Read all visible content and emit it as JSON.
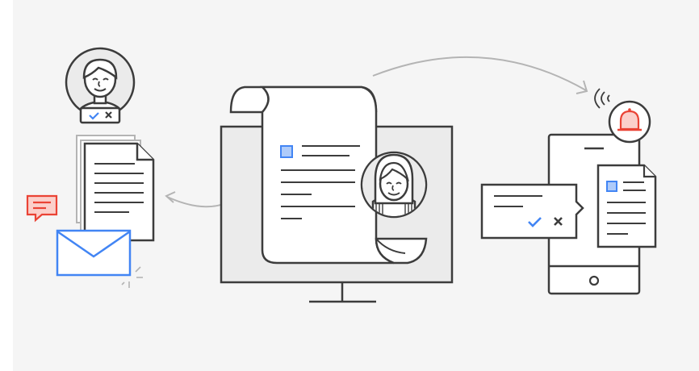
{
  "illustration": {
    "background": "#f5f5f5",
    "colors": {
      "stroke": "#3c3c3c",
      "fill": "#ffffff",
      "screen_fill": "#ebebeb",
      "accent_blue": "#4285f4",
      "accent_blue_light": "#aecbfa",
      "accent_red": "#ea4335",
      "accent_red_light": "#fbd0cb",
      "arrow": "#b4b4b4"
    },
    "icons": {
      "approver_avatar": "user-avatar-icon",
      "approve_mark": "check-icon",
      "reject_mark": "close-icon",
      "documents": "document-stack-icon",
      "comment": "chat-bubble-icon",
      "email": "envelope-icon",
      "monitor": "desktop-monitor-icon",
      "scroll": "document-scroll-icon",
      "signer_avatar": "user-avatar-icon",
      "phone": "mobile-phone-icon",
      "notification": "bell-icon",
      "wifi": "signal-waves-icon"
    }
  }
}
